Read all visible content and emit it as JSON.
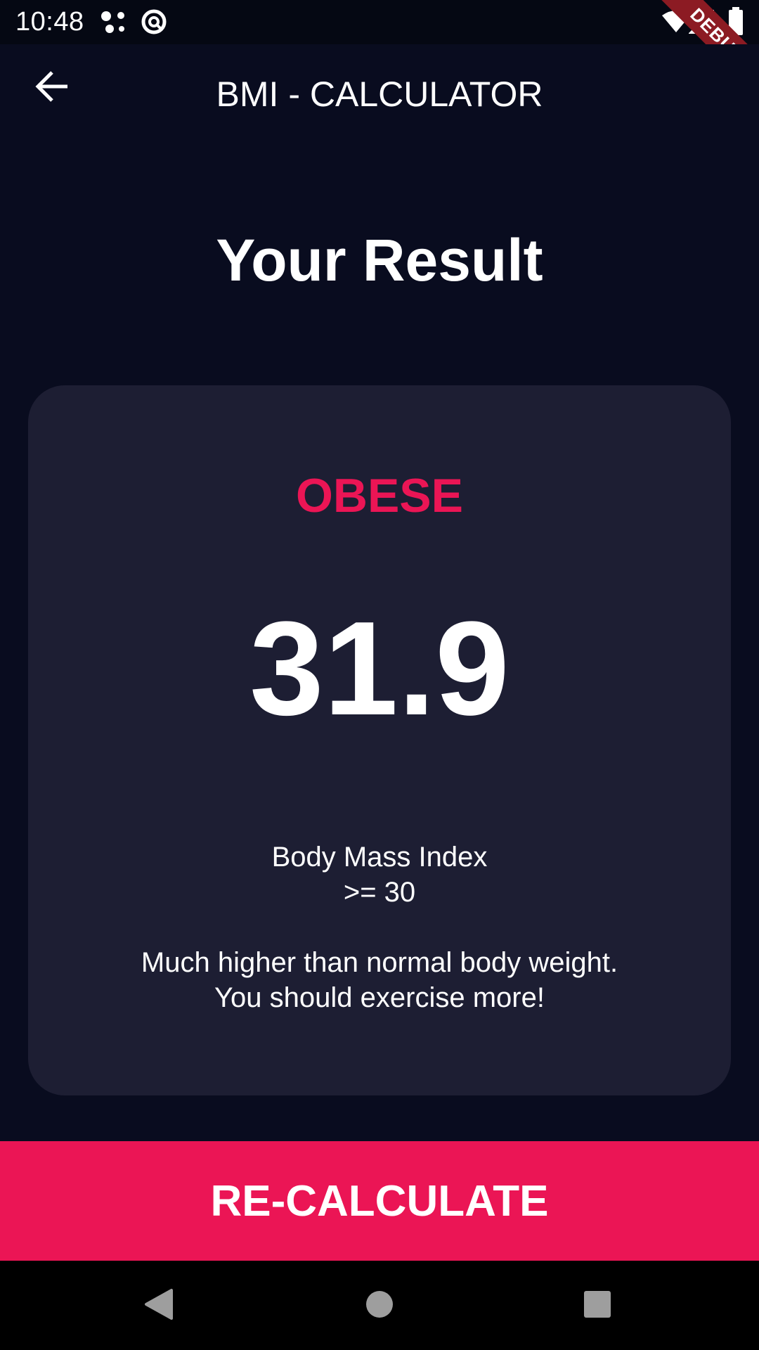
{
  "status_bar": {
    "time": "10:48",
    "icons": [
      "assistant-dots-icon",
      "sync-icon",
      "wifi-icon",
      "signal-icon",
      "battery-icon"
    ]
  },
  "debug_banner": {
    "label": "DEBUG"
  },
  "app_bar": {
    "title": "BMI - CALCULATOR",
    "back_icon": "arrow-back-icon"
  },
  "heading": "Your Result",
  "card": {
    "status": "OBESE",
    "bmi_value": "31.9",
    "label_line1": "Body Mass Index",
    "label_line2": ">= 30",
    "advice_line1": "Much higher than normal body weight.",
    "advice_line2": "You should exercise more!"
  },
  "button": {
    "label": "RE-CALCULATE"
  },
  "nav_bar": {
    "icons": [
      "back-triangle-icon",
      "home-circle-icon",
      "recents-square-icon"
    ]
  },
  "colors": {
    "background": "#090c1f",
    "card": "#1d1e33",
    "accent": "#eb1555",
    "text": "#ffffff"
  }
}
